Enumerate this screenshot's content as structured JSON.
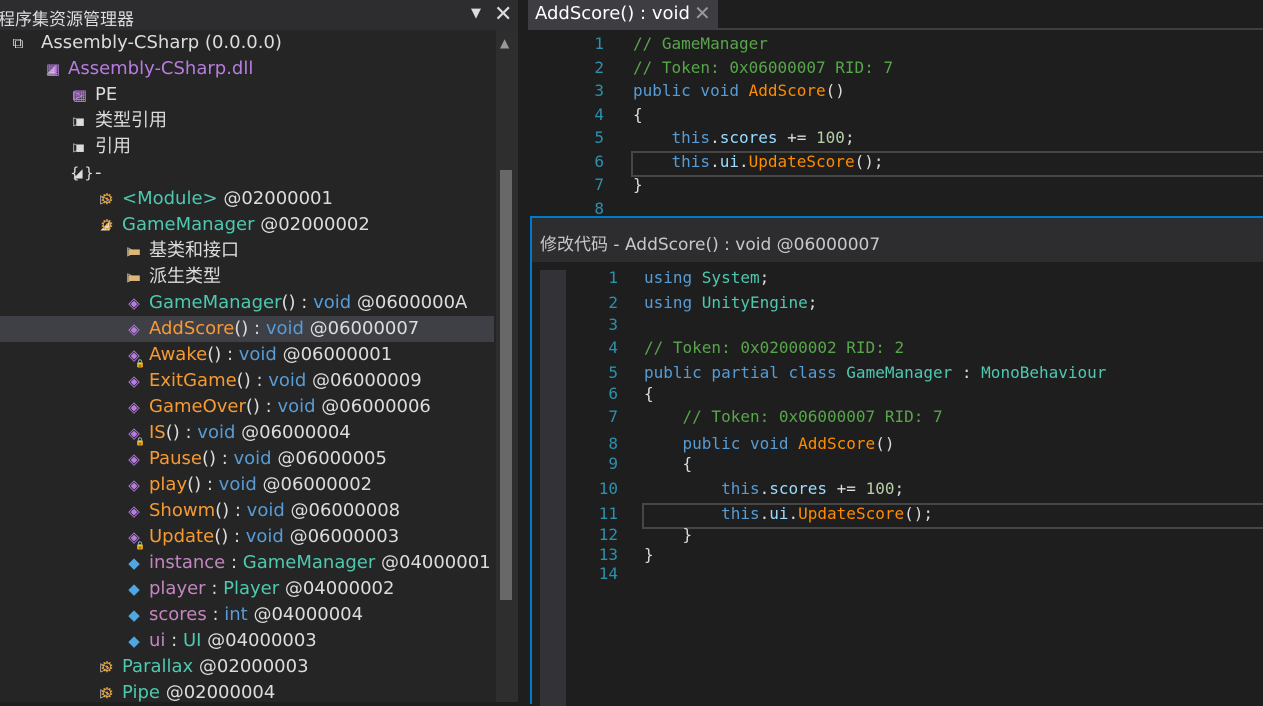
{
  "explorer": {
    "title": "程序集资源管理器",
    "dropdown_icon": "triangle-down-icon",
    "close_icon": "close-icon",
    "tree": [
      {
        "indent": 0,
        "expander": "",
        "icon": "assembly-icon",
        "parts": [
          {
            "t": "Assembly-CSharp (0.0.0.0)",
            "c": "white"
          }
        ]
      },
      {
        "indent": 1,
        "expander": "◢",
        "icon": "module-icon",
        "parts": [
          {
            "t": "Assembly-CSharp.dll",
            "c": "purple"
          }
        ]
      },
      {
        "indent": 2,
        "expander": "▷",
        "icon": "module-icon",
        "parts": [
          {
            "t": "PE",
            "c": "white"
          }
        ]
      },
      {
        "indent": 2,
        "expander": "▷",
        "icon": "reference-icon",
        "parts": [
          {
            "t": "类型引用",
            "c": "white"
          }
        ]
      },
      {
        "indent": 2,
        "expander": "▷",
        "icon": "reference-icon",
        "parts": [
          {
            "t": "引用",
            "c": "white"
          }
        ]
      },
      {
        "indent": 2,
        "expander": "◢",
        "icon": "namespace-icon",
        "parts": [
          {
            "t": "-",
            "c": "white"
          }
        ]
      },
      {
        "indent": 3,
        "expander": "▷",
        "icon": "class-icon",
        "parts": [
          {
            "t": "<Module>",
            "c": "green"
          },
          {
            "t": " @02000001",
            "c": "white"
          }
        ]
      },
      {
        "indent": 3,
        "expander": "◢",
        "icon": "class-icon",
        "parts": [
          {
            "t": "GameManager",
            "c": "green"
          },
          {
            "t": " @02000002",
            "c": "white"
          }
        ]
      },
      {
        "indent": 4,
        "expander": "▷",
        "icon": "folder-icon",
        "parts": [
          {
            "t": "基类和接口",
            "c": "white"
          }
        ]
      },
      {
        "indent": 4,
        "expander": "▷",
        "icon": "folder-icon",
        "parts": [
          {
            "t": "派生类型",
            "c": "white"
          }
        ]
      },
      {
        "indent": 4,
        "expander": "",
        "icon": "method-icon",
        "parts": [
          {
            "t": "GameManager",
            "c": "green"
          },
          {
            "t": "() : ",
            "c": "white"
          },
          {
            "t": "void",
            "c": "blue"
          },
          {
            "t": " @0600000A",
            "c": "white"
          }
        ]
      },
      {
        "indent": 4,
        "expander": "",
        "icon": "method-icon",
        "selected": true,
        "parts": [
          {
            "t": "AddScore",
            "c": "orange"
          },
          {
            "t": "() : ",
            "c": "white"
          },
          {
            "t": "void",
            "c": "blue"
          },
          {
            "t": " @06000007",
            "c": "white"
          }
        ]
      },
      {
        "indent": 4,
        "expander": "",
        "icon": "private-method-icon",
        "parts": [
          {
            "t": "Awake",
            "c": "orange"
          },
          {
            "t": "() : ",
            "c": "white"
          },
          {
            "t": "void",
            "c": "blue"
          },
          {
            "t": " @06000001",
            "c": "white"
          }
        ]
      },
      {
        "indent": 4,
        "expander": "",
        "icon": "method-icon",
        "parts": [
          {
            "t": "ExitGame",
            "c": "orange"
          },
          {
            "t": "() : ",
            "c": "white"
          },
          {
            "t": "void",
            "c": "blue"
          },
          {
            "t": " @06000009",
            "c": "white"
          }
        ]
      },
      {
        "indent": 4,
        "expander": "",
        "icon": "method-icon",
        "parts": [
          {
            "t": "GameOver",
            "c": "orange"
          },
          {
            "t": "() : ",
            "c": "white"
          },
          {
            "t": "void",
            "c": "blue"
          },
          {
            "t": " @06000006",
            "c": "white"
          }
        ]
      },
      {
        "indent": 4,
        "expander": "",
        "icon": "private-method-icon",
        "parts": [
          {
            "t": "IS",
            "c": "orange"
          },
          {
            "t": "() : ",
            "c": "white"
          },
          {
            "t": "void",
            "c": "blue"
          },
          {
            "t": " @06000004",
            "c": "white"
          }
        ]
      },
      {
        "indent": 4,
        "expander": "",
        "icon": "method-icon",
        "parts": [
          {
            "t": "Pause",
            "c": "orange"
          },
          {
            "t": "() : ",
            "c": "white"
          },
          {
            "t": "void",
            "c": "blue"
          },
          {
            "t": " @06000005",
            "c": "white"
          }
        ]
      },
      {
        "indent": 4,
        "expander": "",
        "icon": "method-icon",
        "parts": [
          {
            "t": "play",
            "c": "orange"
          },
          {
            "t": "() : ",
            "c": "white"
          },
          {
            "t": "void",
            "c": "blue"
          },
          {
            "t": " @06000002",
            "c": "white"
          }
        ]
      },
      {
        "indent": 4,
        "expander": "",
        "icon": "method-icon",
        "parts": [
          {
            "t": "Showm",
            "c": "orange"
          },
          {
            "t": "() : ",
            "c": "white"
          },
          {
            "t": "void",
            "c": "blue"
          },
          {
            "t": " @06000008",
            "c": "white"
          }
        ]
      },
      {
        "indent": 4,
        "expander": "",
        "icon": "private-method-icon",
        "parts": [
          {
            "t": "Update",
            "c": "orange"
          },
          {
            "t": "() : ",
            "c": "white"
          },
          {
            "t": "void",
            "c": "blue"
          },
          {
            "t": " @06000003",
            "c": "white"
          }
        ]
      },
      {
        "indent": 4,
        "expander": "",
        "icon": "field-icon",
        "parts": [
          {
            "t": "instance",
            "c": "violet"
          },
          {
            "t": " : ",
            "c": "white"
          },
          {
            "t": "GameManager",
            "c": "green"
          },
          {
            "t": " @04000001",
            "c": "white"
          }
        ]
      },
      {
        "indent": 4,
        "expander": "",
        "icon": "field-icon",
        "parts": [
          {
            "t": "player",
            "c": "violet"
          },
          {
            "t": " : ",
            "c": "white"
          },
          {
            "t": "Player",
            "c": "green"
          },
          {
            "t": " @04000002",
            "c": "white"
          }
        ]
      },
      {
        "indent": 4,
        "expander": "",
        "icon": "field-icon",
        "parts": [
          {
            "t": "scores",
            "c": "violet"
          },
          {
            "t": " : ",
            "c": "white"
          },
          {
            "t": "int",
            "c": "blue"
          },
          {
            "t": " @04000004",
            "c": "white"
          }
        ]
      },
      {
        "indent": 4,
        "expander": "",
        "icon": "field-icon",
        "parts": [
          {
            "t": "ui",
            "c": "violet"
          },
          {
            "t": " : ",
            "c": "white"
          },
          {
            "t": "UI",
            "c": "green"
          },
          {
            "t": " @04000003",
            "c": "white"
          }
        ]
      },
      {
        "indent": 3,
        "expander": "▷",
        "icon": "class-icon",
        "parts": [
          {
            "t": "Parallax",
            "c": "green"
          },
          {
            "t": " @02000003",
            "c": "white"
          }
        ]
      },
      {
        "indent": 3,
        "expander": "▷",
        "icon": "class-icon",
        "parts": [
          {
            "t": "Pipe",
            "c": "green"
          },
          {
            "t": " @02000004",
            "c": "white"
          }
        ]
      }
    ]
  },
  "editor": {
    "tab_label": "AddScore() : void",
    "tab_close_icon": "close-icon",
    "current_line": 6,
    "lines": [
      {
        "n": "1",
        "parts": [
          {
            "t": "// GameManager",
            "c": "cm"
          }
        ]
      },
      {
        "n": "2",
        "parts": [
          {
            "t": "// Token: 0x06000007 RID: 7",
            "c": "cm"
          }
        ]
      },
      {
        "n": "3",
        "parts": [
          {
            "t": "public void ",
            "c": "kw"
          },
          {
            "t": "AddScore",
            "c": "mt"
          },
          {
            "t": "()",
            "c": "pl"
          }
        ]
      },
      {
        "n": "4",
        "parts": [
          {
            "t": "{",
            "c": "pl"
          }
        ]
      },
      {
        "n": "5",
        "parts": [
          {
            "t": "    ",
            "c": "pl"
          },
          {
            "t": "this",
            "c": "kw"
          },
          {
            "t": ".",
            "c": "pl"
          },
          {
            "t": "scores",
            "c": "fd"
          },
          {
            "t": " += ",
            "c": "pl"
          },
          {
            "t": "100",
            "c": "nm"
          },
          {
            "t": ";",
            "c": "pl"
          }
        ]
      },
      {
        "n": "6",
        "parts": [
          {
            "t": "    ",
            "c": "pl"
          },
          {
            "t": "this",
            "c": "kw"
          },
          {
            "t": ".",
            "c": "pl"
          },
          {
            "t": "ui",
            "c": "fd"
          },
          {
            "t": ".",
            "c": "pl"
          },
          {
            "t": "UpdateScore",
            "c": "mt"
          },
          {
            "t": "();",
            "c": "pl"
          }
        ]
      },
      {
        "n": "7",
        "parts": [
          {
            "t": "}",
            "c": "pl"
          }
        ]
      },
      {
        "n": "8",
        "parts": []
      }
    ]
  },
  "dialog": {
    "title": "修改代码 - AddScore() : void @06000007",
    "current_line": 11,
    "lines": [
      {
        "n": "1",
        "parts": [
          {
            "t": "using ",
            "c": "kw"
          },
          {
            "t": "System",
            "c": "ty"
          },
          {
            "t": ";",
            "c": "pl"
          }
        ]
      },
      {
        "n": "2",
        "parts": [
          {
            "t": "using ",
            "c": "kw"
          },
          {
            "t": "UnityEngine",
            "c": "ty"
          },
          {
            "t": ";",
            "c": "pl"
          }
        ]
      },
      {
        "n": "3",
        "parts": []
      },
      {
        "n": "4",
        "parts": [
          {
            "t": "// Token: 0x02000002 RID: 2",
            "c": "cm"
          }
        ]
      },
      {
        "n": "5",
        "parts": [
          {
            "t": "public partial class ",
            "c": "kw"
          },
          {
            "t": "GameManager",
            "c": "ty"
          },
          {
            "t": " : ",
            "c": "pl"
          },
          {
            "t": "MonoBehaviour",
            "c": "ty"
          }
        ]
      },
      {
        "n": "6",
        "parts": [
          {
            "t": "{",
            "c": "pl"
          }
        ]
      },
      {
        "n": "7",
        "parts": [
          {
            "t": "    ",
            "c": "pl"
          },
          {
            "t": "// Token: 0x06000007 RID: 7",
            "c": "cm"
          }
        ]
      },
      {
        "n": "8",
        "parts": [
          {
            "t": "    ",
            "c": "pl"
          },
          {
            "t": "public void ",
            "c": "kw"
          },
          {
            "t": "AddScore",
            "c": "mt"
          },
          {
            "t": "()",
            "c": "pl"
          }
        ]
      },
      {
        "n": "9",
        "parts": [
          {
            "t": "    {",
            "c": "pl"
          }
        ]
      },
      {
        "n": "10",
        "parts": [
          {
            "t": "        ",
            "c": "pl"
          },
          {
            "t": "this",
            "c": "kw"
          },
          {
            "t": ".",
            "c": "pl"
          },
          {
            "t": "scores",
            "c": "fd"
          },
          {
            "t": " += ",
            "c": "pl"
          },
          {
            "t": "100",
            "c": "nm"
          },
          {
            "t": ";",
            "c": "pl"
          }
        ]
      },
      {
        "n": "11",
        "parts": [
          {
            "t": "        ",
            "c": "pl"
          },
          {
            "t": "this",
            "c": "kw"
          },
          {
            "t": ".",
            "c": "pl"
          },
          {
            "t": "ui",
            "c": "fd"
          },
          {
            "t": ".",
            "c": "pl"
          },
          {
            "t": "UpdateScore",
            "c": "mt"
          },
          {
            "t": "();",
            "c": "pl"
          }
        ]
      },
      {
        "n": "12",
        "parts": [
          {
            "t": "    }",
            "c": "pl"
          }
        ]
      },
      {
        "n": "13",
        "parts": [
          {
            "t": "}",
            "c": "pl"
          }
        ]
      },
      {
        "n": "14",
        "parts": []
      }
    ]
  }
}
